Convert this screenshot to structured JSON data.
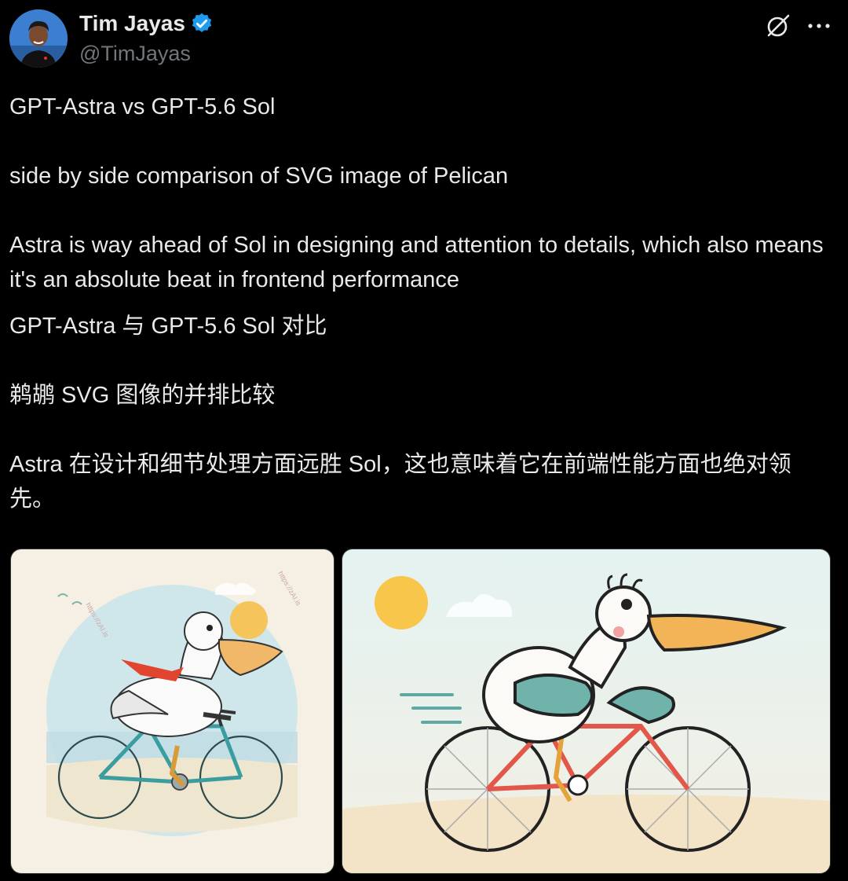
{
  "author": {
    "display_name": "Tim Jayas",
    "handle": "@TimJayas",
    "verified": true,
    "verified_color": "#1d9bf0"
  },
  "icons": {
    "avatar": "profile-photo",
    "verified": "verified-badge-icon",
    "grok": "grok-icon",
    "more": "more-options-icon"
  },
  "tweet": {
    "lines": [
      "GPT-Astra vs GPT-5.6 Sol",
      "side by side comparison of SVG image of Pelican",
      "Astra is way ahead of Sol in designing and attention to details, which also means it's an absolute beat in frontend performance",
      "GPT-Astra 与 GPT-5.6 Sol 对比",
      "鹈鹕 SVG 图像的并排比较",
      "Astra 在设计和细节处理方面远胜 Sol，这也意味着它在前端性能方面也绝对领先。"
    ]
  },
  "media": [
    {
      "subject": "pelican-riding-bicycle-illustration-soft-style",
      "watermark": "https://zAI.is"
    },
    {
      "subject": "pelican-riding-bicycle-illustration-cartoon-style"
    }
  ],
  "colors": {
    "background": "#000000",
    "text": "#e7e9ea",
    "muted": "#71767b",
    "border": "#333639"
  }
}
